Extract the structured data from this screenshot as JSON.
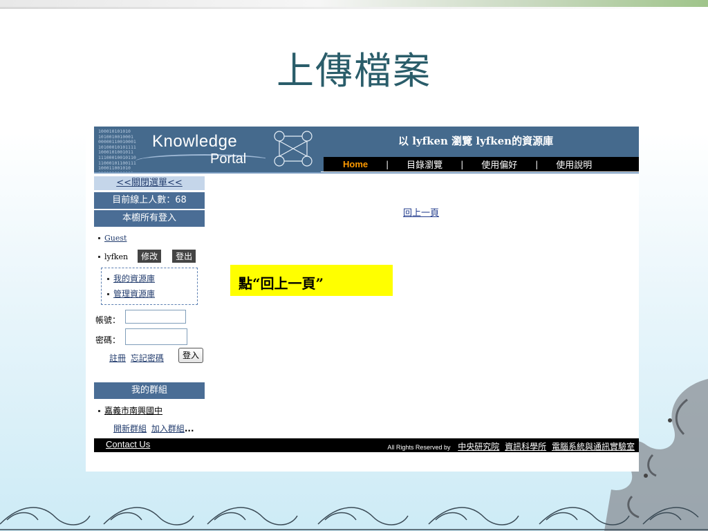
{
  "slide": {
    "title": "上傳檔案"
  },
  "banner": {
    "logo_word1": "Knowledge",
    "logo_word2": "Portal",
    "welcome": "以 lyfken 瀏覽 lyfken的資源庫",
    "nav": [
      "Home",
      "目錄瀏覽",
      "使用偏好",
      "使用說明"
    ],
    "nav_separator": "|"
  },
  "sidebar": {
    "close_menu": "<<關閉選單<<",
    "online_count": "目前線上人數：68",
    "logins_header": "本櫥所有登入",
    "guest": "Guest",
    "user": "lyfken",
    "edit_btn": "修改",
    "logout_btn": "登出",
    "my_repo": "我的資源庫",
    "manage_repo": "管理資源庫",
    "account_label": "帳號：",
    "password_label": "密碼：",
    "register": "註冊",
    "forgot": "忘記密碼",
    "login_btn": "登入",
    "groups_header": "我的群組",
    "group_name": "嘉義市南興國中",
    "new_group": "開新群組",
    "join_group": "加入群組",
    "ellipsis": "..."
  },
  "content": {
    "back_link": "回上一頁",
    "callout": "點“回上一頁”"
  },
  "footer": {
    "contact": "Contact Us",
    "rights_prefix": "All Rights Reserved by",
    "org1": "中央研究院",
    "org2": "資訊科學所",
    "org3": "電腦系統與通訊實驗室"
  },
  "colors": {
    "header_blue": "#456a8d",
    "sidebar_blue": "#4a6d95",
    "nav_home": "#ff9a00",
    "callout_yellow": "#ffff00",
    "title_teal": "#2a5d6a"
  }
}
